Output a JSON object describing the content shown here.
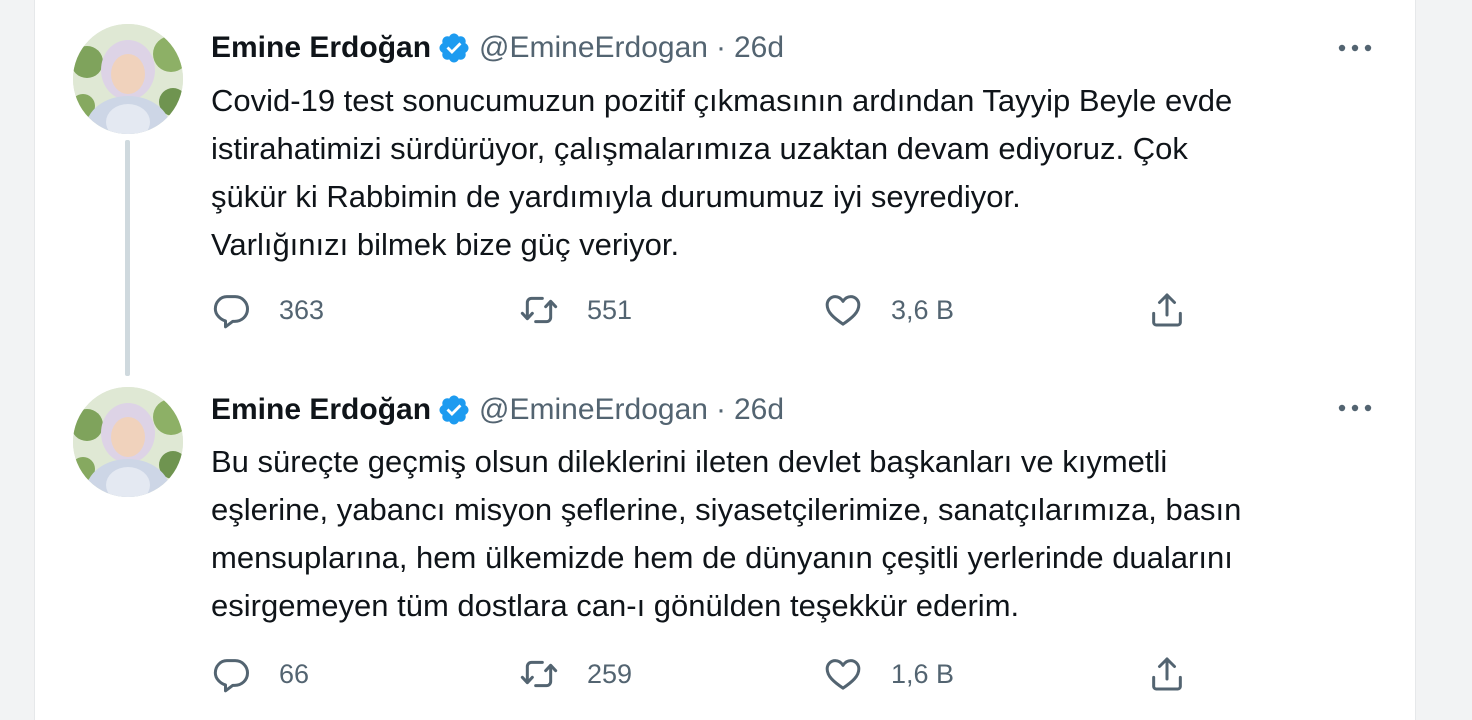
{
  "tweets": [
    {
      "author_name": "Emine Erdoğan",
      "handle": "@EmineErdogan",
      "separator": "·",
      "time": "26d",
      "text_lines": [
        "Covid-19 test sonucumuzun pozitif çıkmasının ardından Tayyip Beyle evde",
        "istirahatimizi sürdürüyor, çalışmalarımıza uzaktan devam ediyoruz. Çok",
        "şükür ki Rabbimin de yardımıyla durumumuz iyi seyrediyor.",
        "Varlığınızı bilmek bize güç veriyor."
      ],
      "replies": "363",
      "retweets": "551",
      "likes": "3,6 B",
      "has_thread_line": true
    },
    {
      "author_name": "Emine Erdoğan",
      "handle": "@EmineErdogan",
      "separator": "·",
      "time": "26d",
      "text_lines": [
        "Bu süreçte geçmiş olsun dileklerini ileten devlet başkanları ve kıymetli",
        "eşlerine, yabancı misyon şeflerine, siyasetçilerimize, sanatçılarımıza, basın",
        "mensuplarına, hem ülkemizde hem de dünyanın çeşitli yerlerinde dualarını",
        "esirgemeyen tüm dostlara can-ı gönülden teşekkür ederim."
      ],
      "replies": "66",
      "retweets": "259",
      "likes": "1,6 B",
      "has_thread_line": false
    }
  ],
  "icons": {
    "verified": "verified-badge-icon",
    "more": "more-options-icon",
    "reply": "reply-icon",
    "retweet": "retweet-icon",
    "like": "heart-icon",
    "share": "share-icon"
  },
  "colors": {
    "verified_badge": "#1d9bf0",
    "secondary_text": "#536471",
    "primary_text": "#0f1419",
    "thread_line": "#cfd9de"
  }
}
